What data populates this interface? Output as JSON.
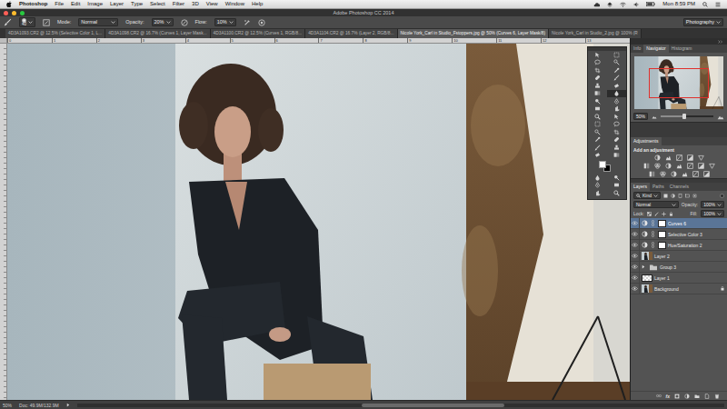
{
  "menubar": {
    "app": "Photoshop",
    "items": [
      "File",
      "Edit",
      "Image",
      "Layer",
      "Type",
      "Select",
      "Filter",
      "3D",
      "View",
      "Window",
      "Help"
    ],
    "clock": "Mon 8:59 PM"
  },
  "window": {
    "title": "Adobe Photoshop CC 2014"
  },
  "options": {
    "brush_size": "40",
    "mode_label": "Mode:",
    "mode": "Normal",
    "opacity_label": "Opacity:",
    "opacity": "20%",
    "flow_label": "Flow:",
    "flow": "10%",
    "workspace": "Photography"
  },
  "tabs": [
    {
      "label": "4D3A1093.CR2 @ 12.5% (Selective Color 1, L...",
      "selected": false
    },
    {
      "label": "4D3A1098.CR2 @ 16.7% (Curves 1, Layer Mask...",
      "selected": false
    },
    {
      "label": "4D3A1100.CR2 @ 12.5% (Curves 1, RGB/8...",
      "selected": false
    },
    {
      "label": "4D3A1104.CR2 @ 16.7% (Layer 2, RGB/8...",
      "selected": false
    },
    {
      "label": "Nicole York_Carl in Studio_Fstoppers.jpg @ 50% (Curves 6, Layer Mask/8)",
      "selected": true
    },
    {
      "label": "Nicole York_Carl in Studio_2.jpg @ 100% (R",
      "selected": false
    }
  ],
  "ruler": {
    "ticks": [
      "0",
      "1",
      "2",
      "3",
      "4",
      "5",
      "6",
      "7",
      "8",
      "9",
      "10",
      "11",
      "12",
      "13"
    ]
  },
  "tools": [
    {
      "selected": false
    },
    {
      "selected": false
    },
    {
      "selected": false
    },
    {
      "selected": false
    },
    {
      "selected": false
    },
    {
      "selected": false
    },
    {
      "selected": false
    },
    {
      "selected": false
    },
    {
      "selected": false
    },
    {
      "selected": false
    },
    {
      "selected": false
    },
    {
      "selected": true
    },
    {
      "selected": false
    },
    {
      "selected": false
    },
    {
      "selected": false
    },
    {
      "selected": false
    },
    {
      "selected": false
    },
    {
      "selected": false
    },
    {
      "selected": false
    },
    {
      "selected": false
    },
    {
      "selected": false
    },
    {
      "selected": false
    },
    {
      "selected": false
    },
    {
      "selected": false
    },
    {
      "selected": false
    },
    {
      "selected": false
    },
    {
      "selected": false
    },
    {
      "selected": false
    },
    {
      "selected": false
    },
    {
      "selected": false
    },
    {
      "selected": false
    },
    {
      "selected": false
    },
    {
      "selected": false
    },
    {
      "selected": false
    }
  ],
  "swatches": {
    "foreground": "#ffffff",
    "background": "#000000"
  },
  "navigator": {
    "tabs": [
      {
        "label": "Info",
        "selected": false
      },
      {
        "label": "Navigator",
        "selected": true
      },
      {
        "label": "Histogram",
        "selected": false
      }
    ],
    "zoom": "50%",
    "level": 0.45
  },
  "adjustments": {
    "tabs": [
      {
        "label": "Adjustments",
        "selected": true
      }
    ],
    "hint": "Add an adjustment"
  },
  "layers": {
    "tabs": [
      {
        "label": "Layers",
        "selected": true
      },
      {
        "label": "Paths",
        "selected": false
      },
      {
        "label": "Channels",
        "selected": false
      }
    ],
    "filter": "Kind",
    "blend": "Normal",
    "opacity_label": "Opacity:",
    "opacity": "100%",
    "lock_label": "Lock:",
    "fill_label": "Fill:",
    "fill": "100%",
    "footer_fx": "fx",
    "items": [
      {
        "name": "Curves 6",
        "kind": "adjustment",
        "visible": true,
        "selected": true,
        "locked": false
      },
      {
        "name": "Selective Color 3",
        "kind": "adjustment",
        "visible": true,
        "selected": false,
        "locked": false
      },
      {
        "name": "Hue/Saturation 2",
        "kind": "adjustment",
        "visible": true,
        "selected": false,
        "locked": false
      },
      {
        "name": "Layer 2",
        "kind": "pixel",
        "visible": true,
        "selected": false,
        "locked": false
      },
      {
        "name": "Group 3",
        "kind": "group",
        "visible": true,
        "selected": false,
        "locked": false
      },
      {
        "name": "Layer 1",
        "kind": "empty",
        "visible": true,
        "selected": false,
        "locked": false
      },
      {
        "name": "Background",
        "kind": "background",
        "visible": true,
        "selected": false,
        "locked": true
      }
    ]
  },
  "status_bar": {
    "zoom": "50%",
    "doc": "Doc: 49.9M/132.9M"
  }
}
